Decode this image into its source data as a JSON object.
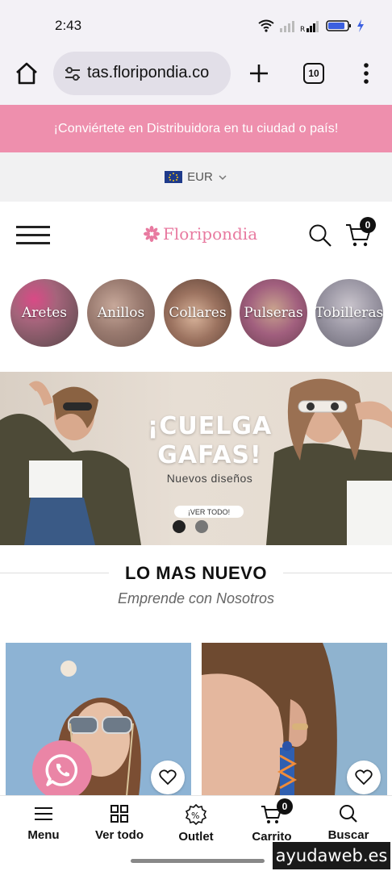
{
  "status_bar": {
    "time": "2:43",
    "icons": [
      "wifi-icon",
      "signal-icon",
      "signal-roaming-icon",
      "battery-icon",
      "charging-icon"
    ]
  },
  "browser": {
    "url": "tas.floripondia.co",
    "tab_count": "10"
  },
  "promo": {
    "text": "¡Conviértete en Distribuidora en tu ciudad o país!"
  },
  "currency": {
    "code": "EUR"
  },
  "header": {
    "logo": "Floripondia",
    "cart_count": "0"
  },
  "categories": [
    {
      "label": "Aretes"
    },
    {
      "label": "Anillos"
    },
    {
      "label": "Collares"
    },
    {
      "label": "Pulseras"
    },
    {
      "label": "Tobilleras"
    }
  ],
  "hero": {
    "title": "¡CUELGA GAFAS!",
    "subtitle": "Nuevos diseños",
    "cta": "¡VER TODO!"
  },
  "section": {
    "title": "LO MAS NUEVO",
    "subtitle": "Emprende con Nosotros"
  },
  "bottom_nav": {
    "items": [
      {
        "label": "Menu",
        "icon": "menu-icon"
      },
      {
        "label": "Ver todo",
        "icon": "grid-icon"
      },
      {
        "label": "Outlet",
        "icon": "percent-badge-icon"
      },
      {
        "label": "Carrito",
        "icon": "cart-icon"
      },
      {
        "label": "Buscar",
        "icon": "search-icon"
      }
    ],
    "cart_count": "0"
  },
  "watermark": "ayudaweb.es",
  "colors": {
    "brand_pink": "#ee8fad",
    "logo_pink": "#e87aa0",
    "whatsapp_bg": "#ea85a6"
  }
}
